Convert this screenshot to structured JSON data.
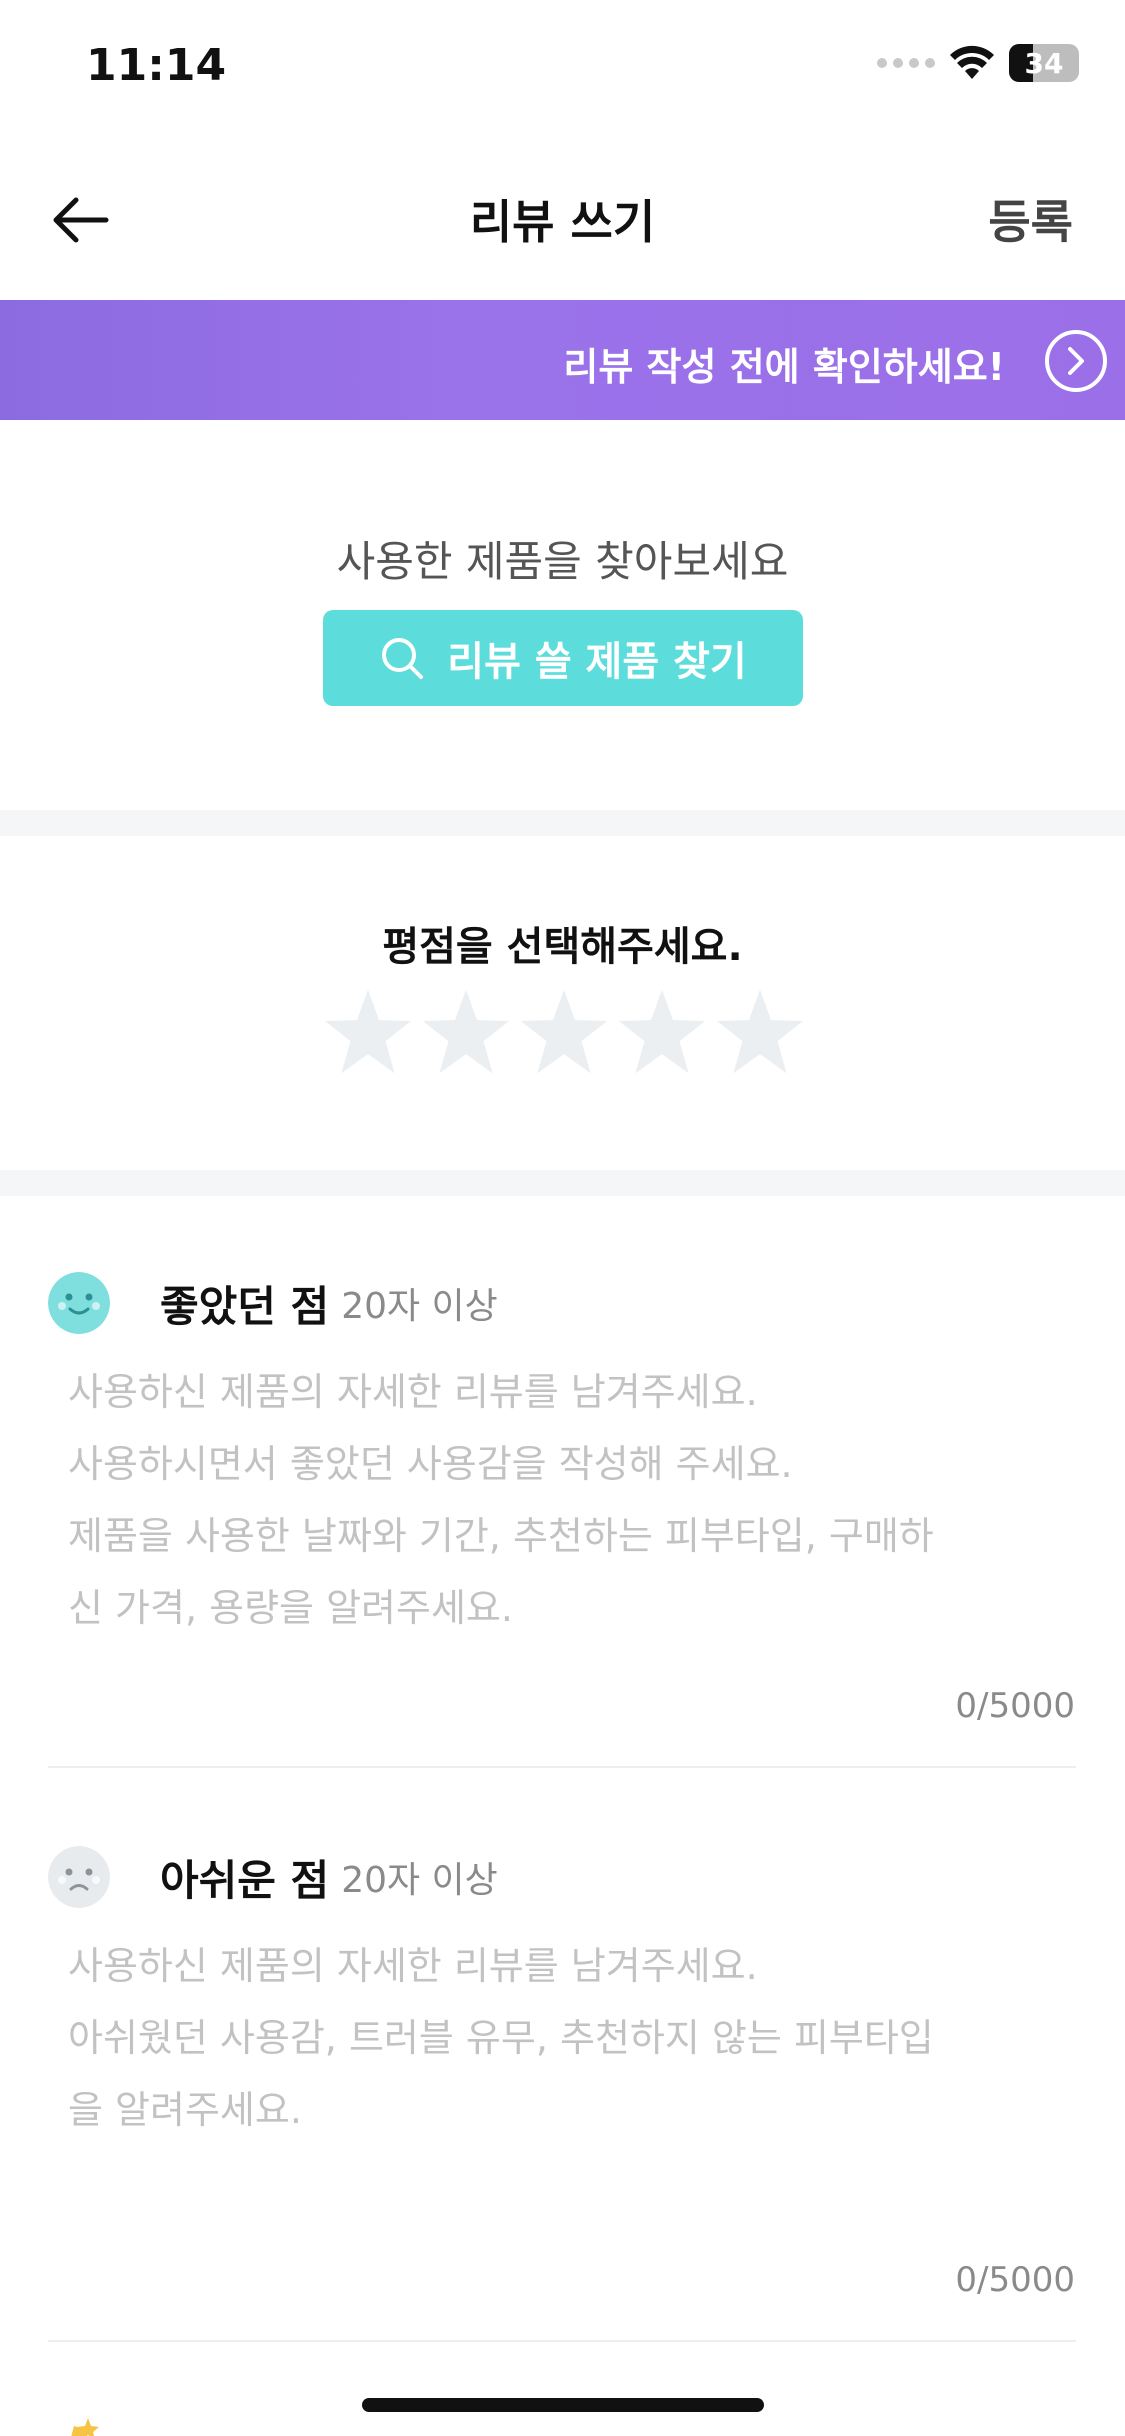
{
  "status_bar": {
    "time": "11:14",
    "battery": "34"
  },
  "header": {
    "title": "리뷰 쓰기",
    "register_label": "등록"
  },
  "banner": {
    "text": "리뷰 작성 전에 확인하세요!"
  },
  "find_product": {
    "prompt": "사용한 제품을 찾아보세요",
    "button_label": "리뷰 쓸 제품 찾기"
  },
  "rating": {
    "title": "평점을 선택해주세요.",
    "stars_total": 5,
    "stars_selected": 0
  },
  "good_points": {
    "label": "좋았던 점",
    "min_length": "20자 이상",
    "placeholder": "사용하신 제품의 자세한 리뷰를 남겨주세요.\n사용하시면서 좋았던 사용감을 작성해 주세요.\n제품을 사용한 날짜와 기간, 추천하는 피부타입, 구매하\n신 가격, 용량을 알려주세요.",
    "count": "0/5000"
  },
  "bad_points": {
    "label": "아쉬운 점",
    "min_length": "20자 이상",
    "placeholder": "사용하신 제품의 자세한 리뷰를 남겨주세요.\n아쉬웠던 사용감, 트러블 유무, 추천하지 않는 피부타입\n을 알려주세요.",
    "count": "0/5000"
  },
  "colors": {
    "banner": "#9a72ea",
    "find_button": "#5ddcdc",
    "star_empty": "#eceff2",
    "placeholder_text": "#c2c2c2"
  }
}
